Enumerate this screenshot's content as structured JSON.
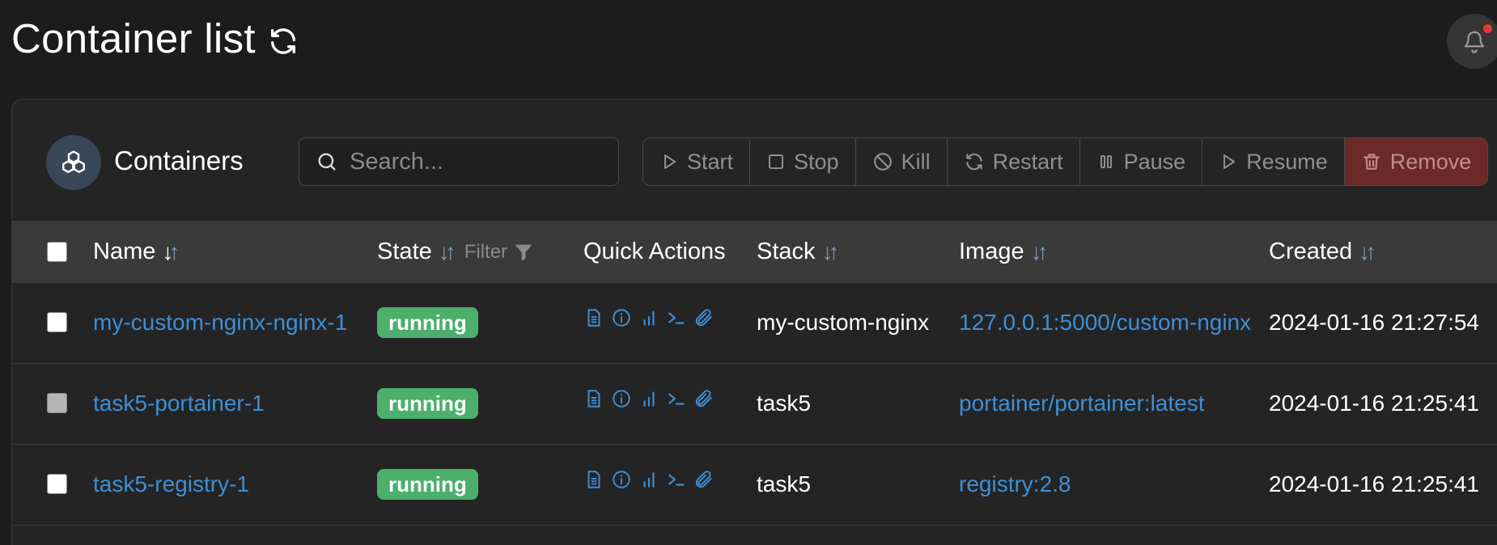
{
  "header": {
    "title": "Container list"
  },
  "panel": {
    "title": "Containers",
    "search_placeholder": "Search...",
    "actions": [
      {
        "label": "Start",
        "icon": "play-icon"
      },
      {
        "label": "Stop",
        "icon": "stop-icon"
      },
      {
        "label": "Kill",
        "icon": "ban-icon"
      },
      {
        "label": "Restart",
        "icon": "restart-icon"
      },
      {
        "label": "Pause",
        "icon": "pause-icon"
      },
      {
        "label": "Resume",
        "icon": "play-icon"
      },
      {
        "label": "Remove",
        "icon": "trash-icon"
      }
    ]
  },
  "table": {
    "columns": {
      "name": "Name",
      "state": "State",
      "filter": "Filter",
      "quick_actions": "Quick Actions",
      "stack": "Stack",
      "image": "Image",
      "created": "Created"
    },
    "rows": [
      {
        "name": "my-custom-nginx-nginx-1",
        "state": "running",
        "stack": "my-custom-nginx",
        "image": "127.0.0.1:5000/custom-nginx",
        "created": "2024-01-16 21:27:54"
      },
      {
        "name": "task5-portainer-1",
        "state": "running",
        "stack": "task5",
        "image": "portainer/portainer:latest",
        "created": "2024-01-16 21:25:41"
      },
      {
        "name": "task5-registry-1",
        "state": "running",
        "stack": "task5",
        "image": "registry:2.8",
        "created": "2024-01-16 21:25:41"
      }
    ]
  },
  "colors": {
    "link": "#3d8fd8",
    "running": "#4caf6b",
    "remove": "#6b2a27",
    "notification_dot": "#e53935"
  }
}
